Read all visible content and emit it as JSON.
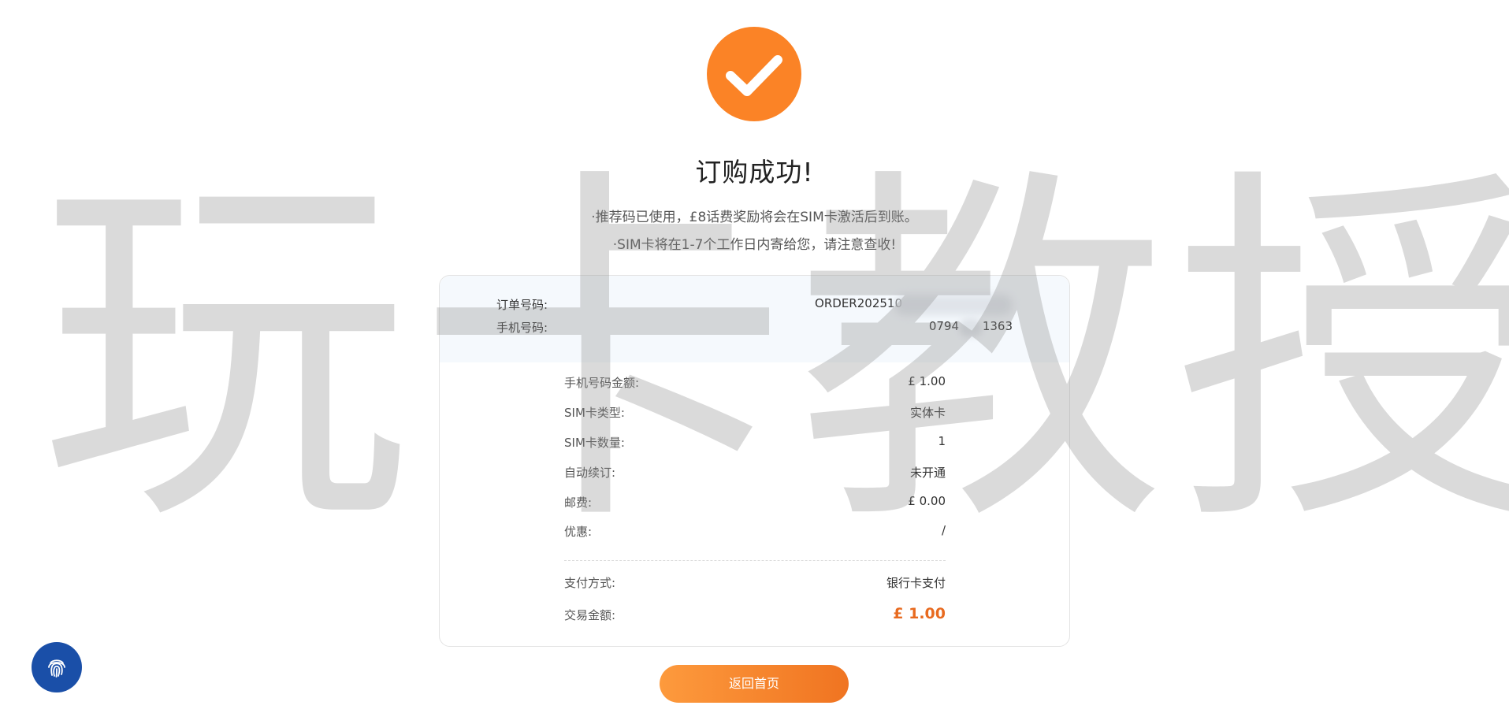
{
  "page": {
    "title": "订购成功!",
    "notices": [
      "·推荐码已使用，£8话费奖励将会在SIM卡激活后到账。",
      "·SIM卡将在1-7个工作日内寄给您，请注意查收!"
    ]
  },
  "order": {
    "order_no_label": "订单号码:",
    "order_no_value": "ORDER202510",
    "phone_label": "手机号码:",
    "phone_value_prefix": "0794",
    "phone_value_suffix": "1363"
  },
  "details": {
    "phone_amount_label": "手机号码金额:",
    "phone_amount_value": "£ 1.00",
    "sim_type_label": "SIM卡类型:",
    "sim_type_value": "实体卡",
    "sim_qty_label": "SIM卡数量:",
    "sim_qty_value": "1",
    "auto_renew_label": "自动续订:",
    "auto_renew_value": "未开通",
    "postage_label": "邮费:",
    "postage_value": "£ 0.00",
    "discount_label": "优惠:",
    "discount_value": "/",
    "payment_method_label": "支付方式:",
    "payment_method_value": "银行卡支付",
    "total_label": "交易金额:",
    "total_value": "£ 1.00"
  },
  "actions": {
    "home_label": "返回首页"
  },
  "watermark": {
    "text": "玩卡教授"
  },
  "icons": {
    "success": "check-icon",
    "fab": "fingerprint-icon"
  },
  "colors": {
    "accent": "#fb8326",
    "total": "#e86a1f",
    "fab": "#1a4fa8"
  }
}
